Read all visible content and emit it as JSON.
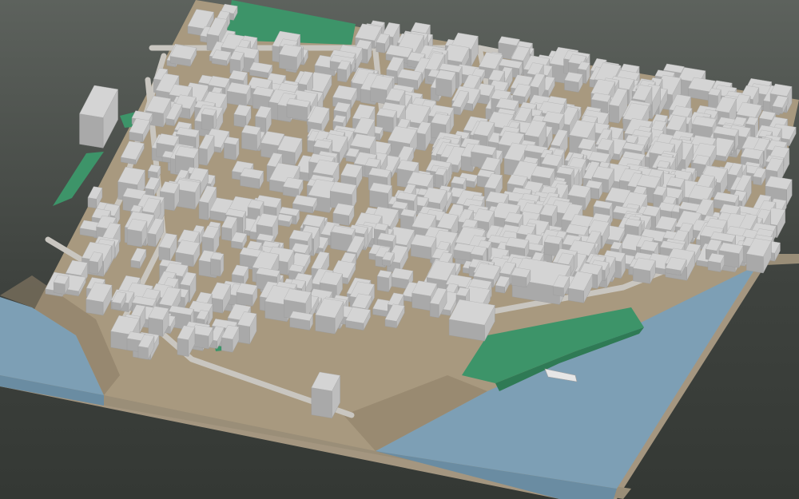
{
  "scene": {
    "subject": "3d-city-block-model",
    "colors": {
      "background_top": "#5d625d",
      "background_bottom": "#343834",
      "ground": "#a8997f",
      "ground_dark": "#8c7d66",
      "slab_side": "#9a8e78",
      "slab_front": "#a49680",
      "water": "#7d9fb5",
      "water_dark": "#6a8ca2",
      "park": "#3d9469",
      "park_dark": "#2f7a55",
      "road": "#c9c6c0",
      "building_top": "#d4d4d4",
      "building_left": "#a9a9a9",
      "building_right": "#bdbdbd"
    }
  }
}
